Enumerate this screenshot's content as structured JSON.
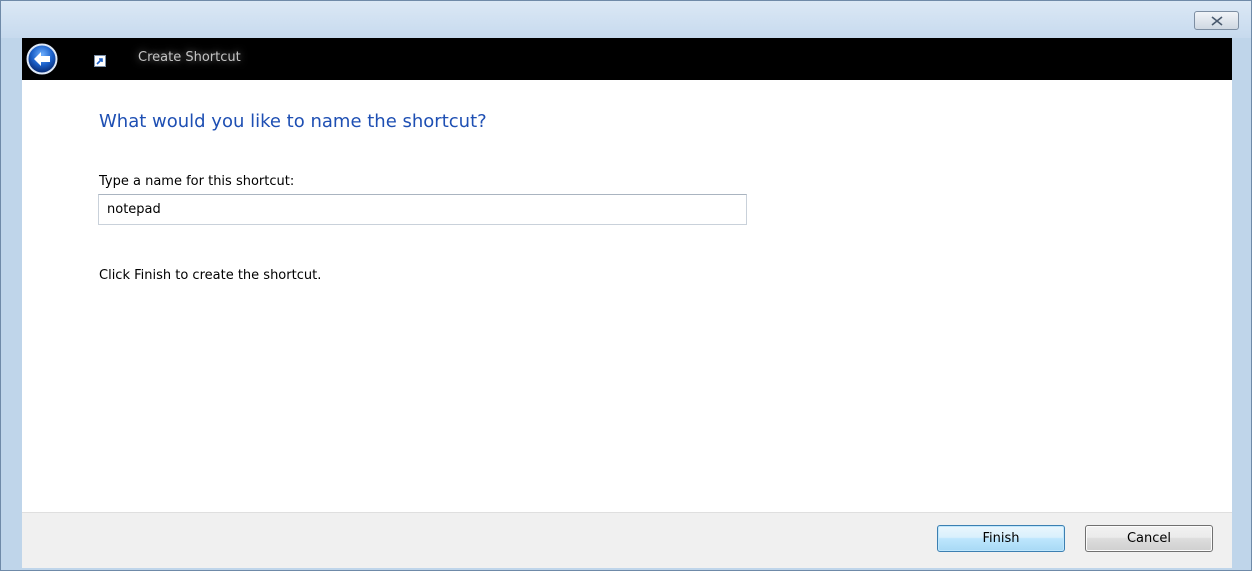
{
  "window": {
    "close_icon": "close-icon",
    "title": "Create Shortcut",
    "back_icon": "back-arrow-icon",
    "title_icon": "shortcut-icon"
  },
  "page": {
    "heading": "What would you like to name the shortcut?",
    "field_label": "Type a name for this shortcut:",
    "name_value": "notepad",
    "hint": "Click Finish to create the shortcut."
  },
  "footer": {
    "finish_label": "Finish",
    "cancel_label": "Cancel"
  },
  "colors": {
    "heading": "#1e4fb3",
    "titlebar": "#000000",
    "frame": "#bfd5ea",
    "back_button": "#1a5fc8"
  }
}
